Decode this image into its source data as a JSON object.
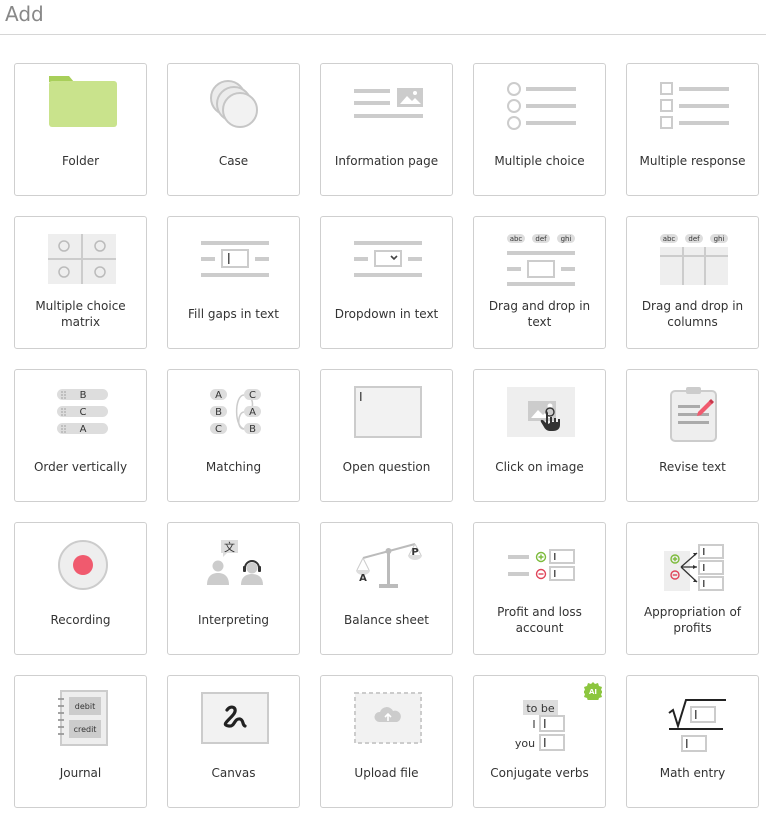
{
  "header": {
    "title": "Add"
  },
  "tiles": [
    {
      "label": "Folder",
      "icon": "folder-icon"
    },
    {
      "label": "Case",
      "icon": "case-icon"
    },
    {
      "label": "Information page",
      "icon": "information-page-icon"
    },
    {
      "label": "Multiple choice",
      "icon": "multiple-choice-icon"
    },
    {
      "label": "Multiple response",
      "icon": "multiple-response-icon"
    },
    {
      "label": "Multiple choice matrix",
      "icon": "matrix-icon"
    },
    {
      "label": "Fill gaps in text",
      "icon": "fill-gaps-icon"
    },
    {
      "label": "Dropdown in text",
      "icon": "dropdown-text-icon"
    },
    {
      "label": "Drag and drop in text",
      "icon": "drag-drop-text-icon"
    },
    {
      "label": "Drag and drop in columns",
      "icon": "drag-drop-columns-icon"
    },
    {
      "label": "Order vertically",
      "icon": "order-vertically-icon"
    },
    {
      "label": "Matching",
      "icon": "matching-icon"
    },
    {
      "label": "Open question",
      "icon": "open-question-icon"
    },
    {
      "label": "Click on image",
      "icon": "click-image-icon"
    },
    {
      "label": "Revise text",
      "icon": "revise-text-icon"
    },
    {
      "label": "Recording",
      "icon": "recording-icon"
    },
    {
      "label": "Interpreting",
      "icon": "interpreting-icon"
    },
    {
      "label": "Balance sheet",
      "icon": "balance-sheet-icon"
    },
    {
      "label": "Profit and loss account",
      "icon": "profit-loss-icon"
    },
    {
      "label": "Appropriation of profits",
      "icon": "appropriation-icon"
    },
    {
      "label": "Journal",
      "icon": "journal-icon"
    },
    {
      "label": "Canvas",
      "icon": "canvas-icon"
    },
    {
      "label": "Upload file",
      "icon": "upload-file-icon"
    },
    {
      "label": "Conjugate verbs",
      "icon": "conjugate-verbs-icon"
    },
    {
      "label": "Math entry",
      "icon": "math-entry-icon"
    }
  ],
  "icon_text": {
    "drag_words": [
      "abc",
      "def",
      "ghi"
    ],
    "order_items": [
      "B",
      "C",
      "A"
    ],
    "match_left": [
      "A",
      "B",
      "C"
    ],
    "match_right": [
      "C",
      "A",
      "B"
    ],
    "translate_glyph": "文",
    "balance_left": "A",
    "balance_right": "P",
    "journal_debit": "debit",
    "journal_credit": "credit",
    "conj_to_be": "to be",
    "conj_i": "I",
    "conj_you": "you",
    "ai_badge": "AI"
  },
  "colors": {
    "folder_green": "#c9e38c",
    "folder_tab": "#a8cf5a",
    "record_red": "#f05a6e",
    "plus_green": "#7dbb3c",
    "minus_red": "#e0455a",
    "ai_green": "#8cc63f"
  }
}
